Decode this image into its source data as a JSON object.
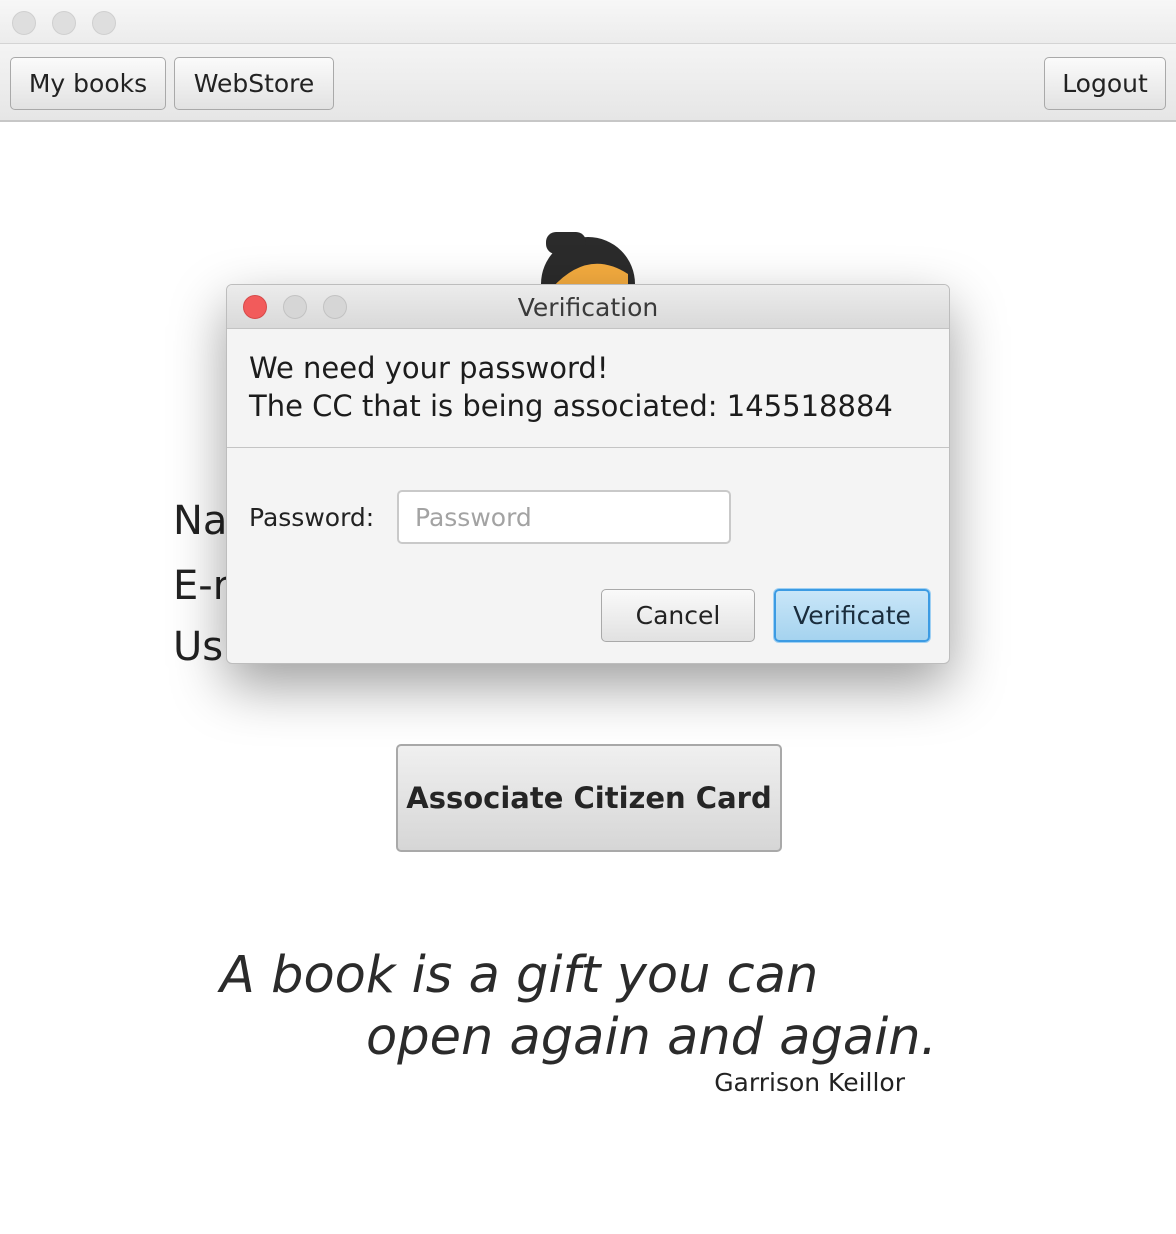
{
  "toolbar": {
    "my_books": "My books",
    "webstore": "WebStore",
    "logout": "Logout"
  },
  "profile": {
    "labels": [
      "Na",
      "E-r",
      "Us"
    ],
    "associate_button": "Associate Citizen Card"
  },
  "quote": {
    "line1": "A book is a gift you can",
    "line2": "open again and again.",
    "author": "Garrison Keillor"
  },
  "dialog": {
    "title": "Verification",
    "header_line1": "We need your password!",
    "header_line2": "The CC that is being associated: 145518884",
    "password_label": "Password:",
    "password_placeholder": "Password",
    "password_value": "",
    "cancel_label": "Cancel",
    "verify_label": "Verificate"
  },
  "colors": {
    "close": "#f25b5b",
    "default_button_border": "#3c9be3",
    "avatar_hair": "#2b2b2b",
    "avatar_face": "#f5ac3f"
  }
}
